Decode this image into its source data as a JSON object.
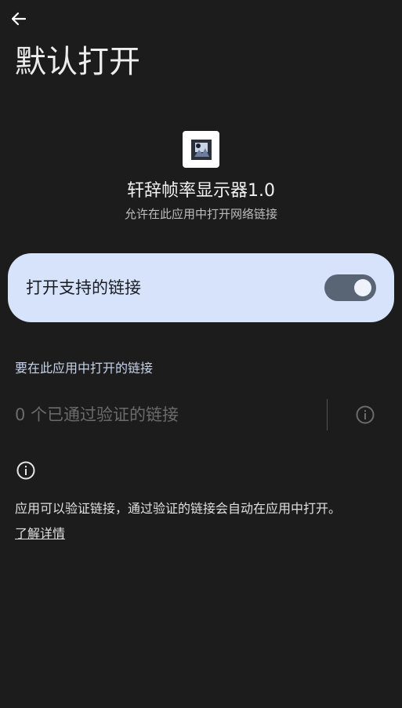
{
  "header": {
    "back_icon": "arrow-left-icon",
    "title": "默认打开"
  },
  "app": {
    "icon": "app-icon",
    "name": "轩辞帧率显示器1.0",
    "subtitle": "允许在此应用中打开网络链接"
  },
  "open_supported_links": {
    "label": "打开支持的链接",
    "enabled": true
  },
  "links_section": {
    "heading": "要在此应用中打开的链接",
    "verified_count_text": "0 个已通过验证的链接",
    "info_icon": "info-icon"
  },
  "footer": {
    "info_icon": "info-icon",
    "description": "应用可以验证链接，通过验证的链接会自动在应用中打开。",
    "learn_more": "了解详情"
  },
  "colors": {
    "background": "#1c1c1c",
    "card": "#d6e3fb",
    "switch_track": "#596474",
    "section_label": "#c7d3ea"
  }
}
